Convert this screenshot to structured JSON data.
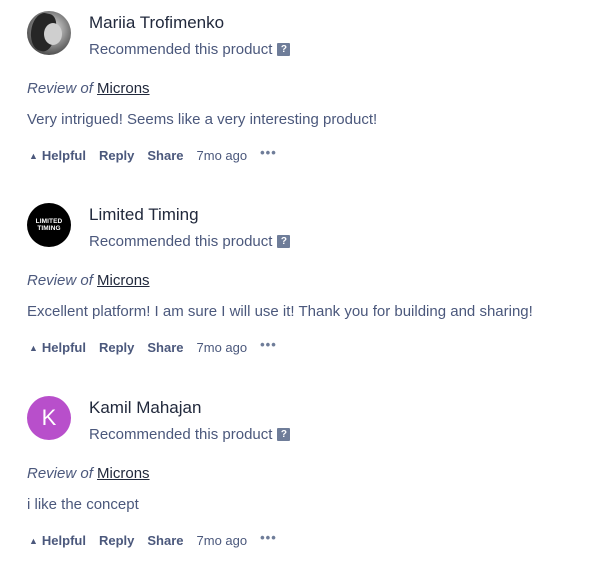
{
  "reviews": [
    {
      "author": "Mariia Trofimenko",
      "avatar": {
        "type": "photo",
        "icon": "user-photo-avatar"
      },
      "recommendation": "Recommended this product",
      "review_of_prefix": "Review of",
      "product": "Microns",
      "text": "Very intrigued! Seems like a very interesting product!",
      "actions": {
        "helpful": "Helpful",
        "reply": "Reply",
        "share": "Share",
        "time": "7mo ago",
        "more": "•••"
      }
    },
    {
      "author": "Limited Timing",
      "avatar": {
        "type": "logo",
        "line1": "LIMITED",
        "line2": "TIMING"
      },
      "recommendation": "Recommended this product",
      "review_of_prefix": "Review of",
      "product": "Microns",
      "text": "Excellent platform! I am sure I will use it! Thank you for building and sharing!",
      "actions": {
        "helpful": "Helpful",
        "reply": "Reply",
        "share": "Share",
        "time": "7mo ago",
        "more": "•••"
      }
    },
    {
      "author": "Kamil Mahajan",
      "avatar": {
        "type": "initial",
        "letter": "K",
        "color": "#b84fcb"
      },
      "recommendation": "Recommended this product",
      "review_of_prefix": "Review of",
      "product": "Microns",
      "text": "i like the concept",
      "actions": {
        "helpful": "Helpful",
        "reply": "Reply",
        "share": "Share",
        "time": "7mo ago",
        "more": "•••"
      }
    }
  ],
  "icons": {
    "help": "?",
    "upvote": "▲"
  },
  "colors": {
    "primary_text": "#21293c",
    "secondary_text": "#4b587c",
    "help_badge": "#6f7d99"
  }
}
